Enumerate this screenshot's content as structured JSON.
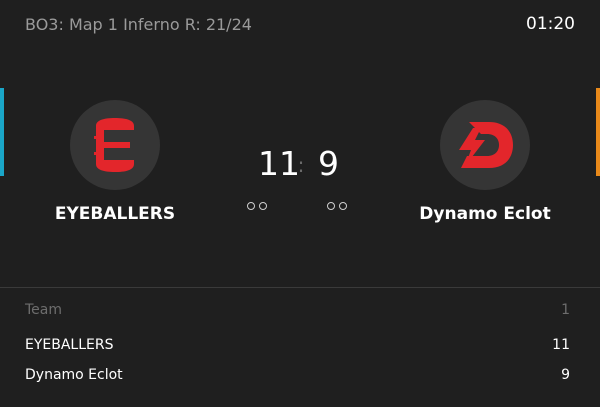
{
  "header": {
    "match_info": "BO3: Map 1 Inferno R: 21/24",
    "clock": "01:20"
  },
  "teams": [
    {
      "name": "EYEBALLERS",
      "score": "11",
      "side_color": "#1aa6c8",
      "logo_color": "#e3262b",
      "logo_icon": "eyeballers-logo"
    },
    {
      "name": "Dynamo Eclot",
      "score": "9",
      "side_color": "#e8891a",
      "logo_color": "#e3262b",
      "logo_icon": "dynamo-eclot-logo"
    }
  ],
  "score_separator": ":",
  "table": {
    "header": {
      "col1": "Team",
      "col2": "1"
    },
    "rows": [
      {
        "team": "EYEBALLERS",
        "value": "11"
      },
      {
        "team": "Dynamo Eclot",
        "value": "9"
      }
    ]
  },
  "colors": {
    "background": "#1f1f1f",
    "logo_circle": "#353535",
    "muted_text": "#9a9a9a"
  }
}
